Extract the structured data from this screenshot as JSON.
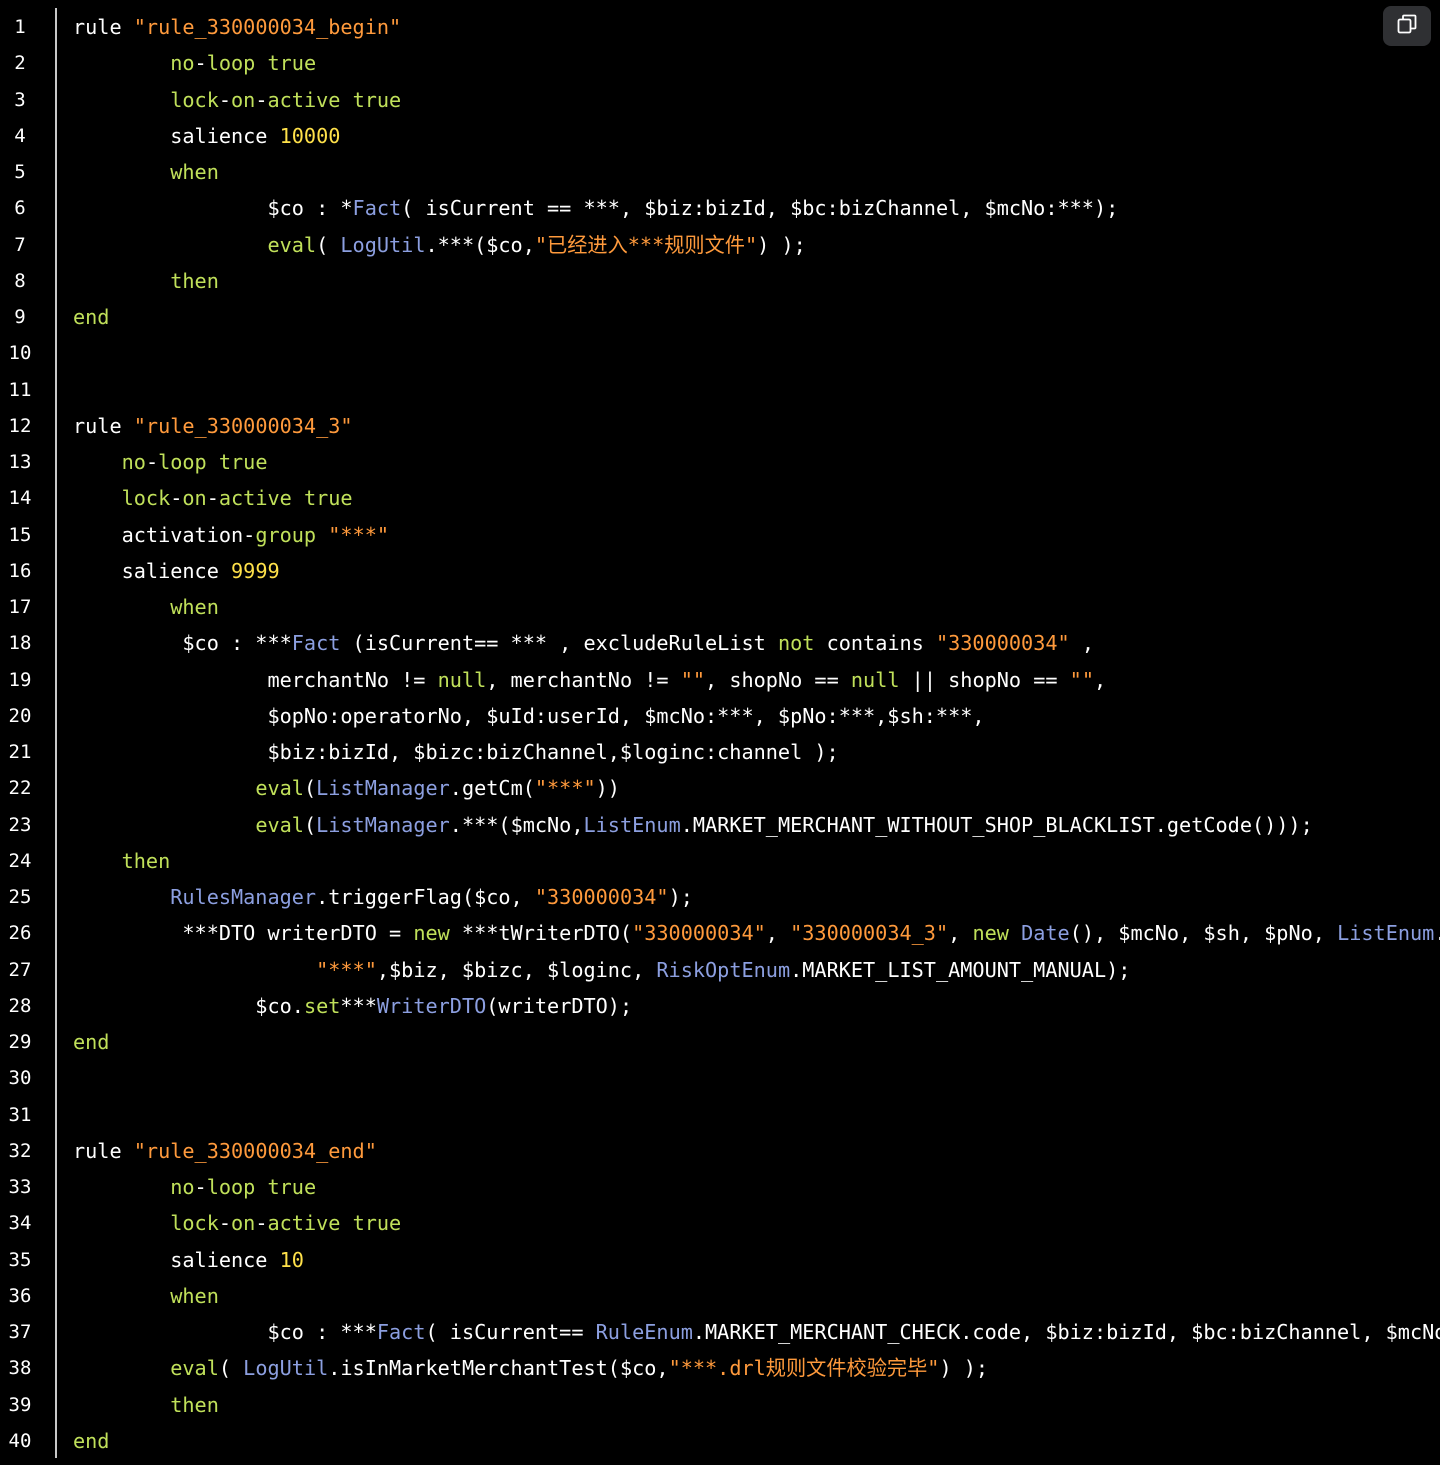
{
  "copy_button": {
    "icon": "copy-icon"
  },
  "colors": {
    "background": "#000000",
    "text": "#ffffff",
    "keyword": "#c0e05a",
    "string": "#ff9a3c",
    "number": "#ffe14a",
    "class": "#8c9fe0",
    "gutter": "#c8c8c8"
  },
  "lines": [
    {
      "number": "1",
      "tokens": [
        {
          "t": "rule ",
          "c": "text"
        },
        {
          "t": "\"rule_330000034_begin\"",
          "c": "string"
        }
      ]
    },
    {
      "number": "2",
      "tokens": [
        {
          "t": "        ",
          "c": "text"
        },
        {
          "t": "no",
          "c": "keyword"
        },
        {
          "t": "-",
          "c": "text"
        },
        {
          "t": "loop",
          "c": "keyword"
        },
        {
          "t": " ",
          "c": "text"
        },
        {
          "t": "true",
          "c": "keyword"
        }
      ]
    },
    {
      "number": "3",
      "tokens": [
        {
          "t": "        ",
          "c": "text"
        },
        {
          "t": "lock",
          "c": "keyword"
        },
        {
          "t": "-",
          "c": "text"
        },
        {
          "t": "on",
          "c": "keyword"
        },
        {
          "t": "-",
          "c": "text"
        },
        {
          "t": "active",
          "c": "keyword"
        },
        {
          "t": " ",
          "c": "text"
        },
        {
          "t": "true",
          "c": "keyword"
        }
      ]
    },
    {
      "number": "4",
      "tokens": [
        {
          "t": "        salience ",
          "c": "text"
        },
        {
          "t": "10000",
          "c": "number"
        }
      ]
    },
    {
      "number": "5",
      "tokens": [
        {
          "t": "        ",
          "c": "text"
        },
        {
          "t": "when",
          "c": "keyword"
        }
      ]
    },
    {
      "number": "6",
      "tokens": [
        {
          "t": "                $co : *",
          "c": "text"
        },
        {
          "t": "Fact",
          "c": "class"
        },
        {
          "t": "( isCurrent == ***, $biz:bizId, $bc:bizChannel, $mcNo:***);",
          "c": "text"
        }
      ]
    },
    {
      "number": "7",
      "tokens": [
        {
          "t": "                ",
          "c": "text"
        },
        {
          "t": "eval",
          "c": "keyword"
        },
        {
          "t": "( ",
          "c": "text"
        },
        {
          "t": "LogUtil",
          "c": "class"
        },
        {
          "t": ".***($co,",
          "c": "text"
        },
        {
          "t": "\"已经进入***规则文件\"",
          "c": "string"
        },
        {
          "t": ") );",
          "c": "text"
        }
      ]
    },
    {
      "number": "8",
      "tokens": [
        {
          "t": "        ",
          "c": "text"
        },
        {
          "t": "then",
          "c": "keyword"
        }
      ]
    },
    {
      "number": "9",
      "tokens": [
        {
          "t": "end",
          "c": "keyword"
        }
      ]
    },
    {
      "number": "10",
      "tokens": []
    },
    {
      "number": "11",
      "tokens": []
    },
    {
      "number": "12",
      "tokens": [
        {
          "t": "rule ",
          "c": "text"
        },
        {
          "t": "\"rule_330000034_3\"",
          "c": "string"
        }
      ]
    },
    {
      "number": "13",
      "tokens": [
        {
          "t": "    ",
          "c": "text"
        },
        {
          "t": "no",
          "c": "keyword"
        },
        {
          "t": "-",
          "c": "text"
        },
        {
          "t": "loop",
          "c": "keyword"
        },
        {
          "t": " ",
          "c": "text"
        },
        {
          "t": "true",
          "c": "keyword"
        }
      ]
    },
    {
      "number": "14",
      "tokens": [
        {
          "t": "    ",
          "c": "text"
        },
        {
          "t": "lock",
          "c": "keyword"
        },
        {
          "t": "-",
          "c": "text"
        },
        {
          "t": "on",
          "c": "keyword"
        },
        {
          "t": "-",
          "c": "text"
        },
        {
          "t": "active",
          "c": "keyword"
        },
        {
          "t": " ",
          "c": "text"
        },
        {
          "t": "true",
          "c": "keyword"
        }
      ]
    },
    {
      "number": "15",
      "tokens": [
        {
          "t": "    activation-",
          "c": "text"
        },
        {
          "t": "group",
          "c": "keyword"
        },
        {
          "t": " ",
          "c": "text"
        },
        {
          "t": "\"***\"",
          "c": "string"
        }
      ]
    },
    {
      "number": "16",
      "tokens": [
        {
          "t": "    salience ",
          "c": "text"
        },
        {
          "t": "9999",
          "c": "number"
        }
      ]
    },
    {
      "number": "17",
      "tokens": [
        {
          "t": "        ",
          "c": "text"
        },
        {
          "t": "when",
          "c": "keyword"
        }
      ]
    },
    {
      "number": "18",
      "tokens": [
        {
          "t": "         $co : ***",
          "c": "text"
        },
        {
          "t": "Fact",
          "c": "class"
        },
        {
          "t": " (isCurrent== *** , excludeRuleList ",
          "c": "text"
        },
        {
          "t": "not",
          "c": "keyword"
        },
        {
          "t": " contains ",
          "c": "text"
        },
        {
          "t": "\"330000034\"",
          "c": "string"
        },
        {
          "t": " ,",
          "c": "text"
        }
      ]
    },
    {
      "number": "19",
      "tokens": [
        {
          "t": "                merchantNo != ",
          "c": "text"
        },
        {
          "t": "null",
          "c": "keyword"
        },
        {
          "t": ", merchantNo != ",
          "c": "text"
        },
        {
          "t": "\"\"",
          "c": "string"
        },
        {
          "t": ", shopNo == ",
          "c": "text"
        },
        {
          "t": "null",
          "c": "keyword"
        },
        {
          "t": " || shopNo == ",
          "c": "text"
        },
        {
          "t": "\"\"",
          "c": "string"
        },
        {
          "t": ",",
          "c": "text"
        }
      ]
    },
    {
      "number": "20",
      "tokens": [
        {
          "t": "                $opNo:operatorNo, $uId:userId, $mcNo:***, $pNo:***,$sh:***,",
          "c": "text"
        }
      ]
    },
    {
      "number": "21",
      "tokens": [
        {
          "t": "                $biz:bizId, $bizc:bizChannel,$loginc:channel );",
          "c": "text"
        }
      ]
    },
    {
      "number": "22",
      "tokens": [
        {
          "t": "               ",
          "c": "text"
        },
        {
          "t": "eval",
          "c": "keyword"
        },
        {
          "t": "(",
          "c": "text"
        },
        {
          "t": "ListManager",
          "c": "class"
        },
        {
          "t": ".getCm(",
          "c": "text"
        },
        {
          "t": "\"***\"",
          "c": "string"
        },
        {
          "t": "))",
          "c": "text"
        }
      ]
    },
    {
      "number": "23",
      "tokens": [
        {
          "t": "               ",
          "c": "text"
        },
        {
          "t": "eval",
          "c": "keyword"
        },
        {
          "t": "(",
          "c": "text"
        },
        {
          "t": "ListManager",
          "c": "class"
        },
        {
          "t": ".***($mcNo,",
          "c": "text"
        },
        {
          "t": "ListEnum",
          "c": "class"
        },
        {
          "t": ".MARKET_MERCHANT_WITHOUT_SHOP_BLACKLIST.getCode()));",
          "c": "text"
        }
      ]
    },
    {
      "number": "24",
      "tokens": [
        {
          "t": "    ",
          "c": "text"
        },
        {
          "t": "then",
          "c": "keyword"
        }
      ]
    },
    {
      "number": "25",
      "tokens": [
        {
          "t": "        ",
          "c": "text"
        },
        {
          "t": "RulesManager",
          "c": "class"
        },
        {
          "t": ".triggerFlag($co, ",
          "c": "text"
        },
        {
          "t": "\"330000034\"",
          "c": "string"
        },
        {
          "t": ");",
          "c": "text"
        }
      ]
    },
    {
      "number": "26",
      "tokens": [
        {
          "t": "         ***DTO writerDTO = ",
          "c": "text"
        },
        {
          "t": "new",
          "c": "keyword"
        },
        {
          "t": " ***tWriterDTO(",
          "c": "text"
        },
        {
          "t": "\"330000034\"",
          "c": "string"
        },
        {
          "t": ", ",
          "c": "text"
        },
        {
          "t": "\"330000034_3\"",
          "c": "string"
        },
        {
          "t": ", ",
          "c": "text"
        },
        {
          "t": "new",
          "c": "keyword"
        },
        {
          "t": " ",
          "c": "text"
        },
        {
          "t": "Date",
          "c": "class"
        },
        {
          "t": "(), $mcNo, $sh, $pNo, ",
          "c": "text"
        },
        {
          "t": "ListEnum",
          "c": "class"
        },
        {
          "t": ".MARKET_",
          "c": "text"
        }
      ]
    },
    {
      "number": "27",
      "tokens": [
        {
          "t": "                    ",
          "c": "text"
        },
        {
          "t": "\"***\"",
          "c": "string"
        },
        {
          "t": ",$biz, $bizc, $loginc, ",
          "c": "text"
        },
        {
          "t": "RiskOptEnum",
          "c": "class"
        },
        {
          "t": ".MARKET_LIST_AMOUNT_MANUAL);",
          "c": "text"
        }
      ]
    },
    {
      "number": "28",
      "tokens": [
        {
          "t": "               $co.",
          "c": "text"
        },
        {
          "t": "set",
          "c": "keyword"
        },
        {
          "t": "***",
          "c": "text"
        },
        {
          "t": "WriterDTO",
          "c": "class"
        },
        {
          "t": "(writerDTO);",
          "c": "text"
        }
      ]
    },
    {
      "number": "29",
      "tokens": [
        {
          "t": "end",
          "c": "keyword"
        }
      ]
    },
    {
      "number": "30",
      "tokens": []
    },
    {
      "number": "31",
      "tokens": []
    },
    {
      "number": "32",
      "tokens": [
        {
          "t": "rule ",
          "c": "text"
        },
        {
          "t": "\"rule_330000034_end\"",
          "c": "string"
        }
      ]
    },
    {
      "number": "33",
      "tokens": [
        {
          "t": "        ",
          "c": "text"
        },
        {
          "t": "no",
          "c": "keyword"
        },
        {
          "t": "-",
          "c": "text"
        },
        {
          "t": "loop",
          "c": "keyword"
        },
        {
          "t": " ",
          "c": "text"
        },
        {
          "t": "true",
          "c": "keyword"
        }
      ]
    },
    {
      "number": "34",
      "tokens": [
        {
          "t": "        ",
          "c": "text"
        },
        {
          "t": "lock",
          "c": "keyword"
        },
        {
          "t": "-",
          "c": "text"
        },
        {
          "t": "on",
          "c": "keyword"
        },
        {
          "t": "-",
          "c": "text"
        },
        {
          "t": "active",
          "c": "keyword"
        },
        {
          "t": " ",
          "c": "text"
        },
        {
          "t": "true",
          "c": "keyword"
        }
      ]
    },
    {
      "number": "35",
      "tokens": [
        {
          "t": "        salience ",
          "c": "text"
        },
        {
          "t": "10",
          "c": "number"
        }
      ]
    },
    {
      "number": "36",
      "tokens": [
        {
          "t": "        ",
          "c": "text"
        },
        {
          "t": "when",
          "c": "keyword"
        }
      ]
    },
    {
      "number": "37",
      "tokens": [
        {
          "t": "                $co : ***",
          "c": "text"
        },
        {
          "t": "Fact",
          "c": "class"
        },
        {
          "t": "( isCurrent== ",
          "c": "text"
        },
        {
          "t": "RuleEnum",
          "c": "class"
        },
        {
          "t": ".MARKET_MERCHANT_CHECK.code, $biz:bizId, $bc:bizChannel, $mcNo:***);",
          "c": "text"
        }
      ]
    },
    {
      "number": "38",
      "tokens": [
        {
          "t": "        ",
          "c": "text"
        },
        {
          "t": "eval",
          "c": "keyword"
        },
        {
          "t": "( ",
          "c": "text"
        },
        {
          "t": "LogUtil",
          "c": "class"
        },
        {
          "t": ".isInMarketMerchantTest($co,",
          "c": "text"
        },
        {
          "t": "\"***.drl规则文件校验完毕\"",
          "c": "string"
        },
        {
          "t": ") );",
          "c": "text"
        }
      ]
    },
    {
      "number": "39",
      "tokens": [
        {
          "t": "        ",
          "c": "text"
        },
        {
          "t": "then",
          "c": "keyword"
        }
      ]
    },
    {
      "number": "40",
      "tokens": [
        {
          "t": "end",
          "c": "keyword"
        }
      ]
    }
  ]
}
